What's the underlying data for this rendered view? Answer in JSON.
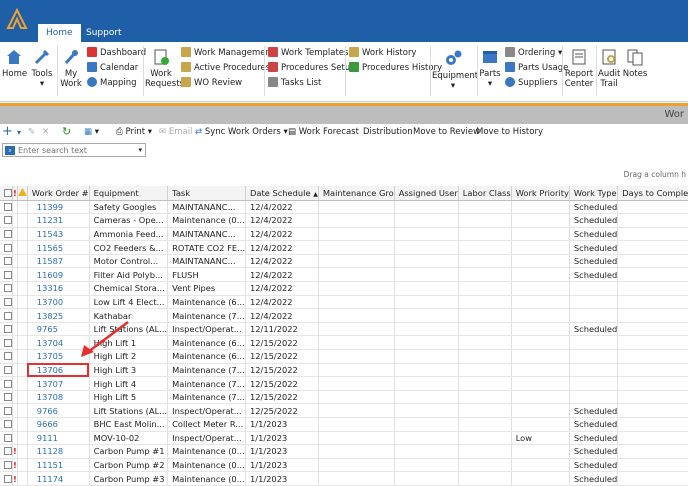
{
  "ribbon_tabs": {
    "home": "Home",
    "support": "Support"
  },
  "ribbon": {
    "home": "Home",
    "tools": "Tools",
    "my_work": "My Work",
    "dashboard": "Dashboard",
    "calendar": "Calendar",
    "mapping": "Mapping",
    "work_requests": "Work Requests",
    "work_management": "Work Management",
    "active_procedures": "Active Procedures",
    "wo_review": "WO Review",
    "work_templates": "Work Templates",
    "procedures_setup": "Procedures Setup",
    "tasks_list": "Tasks List",
    "work_history": "Work History",
    "procedures_history": "Procedures History",
    "equipment": "Equipment",
    "parts": "Parts",
    "ordering": "Ordering",
    "parts_usage": "Parts Usage",
    "suppliers": "Suppliers",
    "report_center": "Report Center",
    "audit_trail": "Audit Trail",
    "notes": "Notes"
  },
  "page_title_partial": "Wor",
  "toolbar": {
    "print": "Print",
    "email": "Email",
    "sync": "Sync Work Orders",
    "forecast": "Work Forecast",
    "distribution": "Distribution",
    "move_review": "Move to Review",
    "move_history": "Move to History"
  },
  "search": {
    "placeholder": "Enter search text"
  },
  "drag_hint": "Drag a column h",
  "columns": [
    "!",
    "Work Order #",
    "Equipment",
    "Task",
    "Date Schedule",
    "Maintenance Gro",
    "Assigned User",
    "Labor Class",
    "Work Priority",
    "Work Type",
    "Days to Complet"
  ],
  "rows": [
    {
      "p": "",
      "wo": "11399",
      "eq": "Safety Googles",
      "task": "MAINTANANC...",
      "date": "12/4/2022",
      "prio": "",
      "type": "Scheduled"
    },
    {
      "p": "",
      "wo": "11231",
      "eq": "Cameras - Ope...",
      "task": "Maintenance (0...",
      "date": "12/4/2022",
      "prio": "",
      "type": "Scheduled"
    },
    {
      "p": "",
      "wo": "11543",
      "eq": "Ammonia Feed...",
      "task": "MAINTANANC...",
      "date": "12/4/2022",
      "prio": "",
      "type": "Scheduled"
    },
    {
      "p": "",
      "wo": "11565",
      "eq": "CO2 Feeders &...",
      "task": "ROTATE CO2 FE...",
      "date": "12/4/2022",
      "prio": "",
      "type": "Scheduled"
    },
    {
      "p": "",
      "wo": "11587",
      "eq": "Motor Control...",
      "task": "MAINTANANC...",
      "date": "12/4/2022",
      "prio": "",
      "type": "Scheduled"
    },
    {
      "p": "",
      "wo": "11609",
      "eq": "Filter Aid Polyb...",
      "task": "FLUSH",
      "date": "12/4/2022",
      "prio": "",
      "type": "Scheduled"
    },
    {
      "p": "",
      "wo": "13316",
      "eq": "Chemical Stora...",
      "task": "Vent Pipes",
      "date": "12/4/2022",
      "prio": "",
      "type": ""
    },
    {
      "p": "",
      "wo": "13700",
      "eq": "Low Lift 4 Elect...",
      "task": "Maintenance (6...",
      "date": "12/4/2022",
      "prio": "",
      "type": ""
    },
    {
      "p": "",
      "wo": "13825",
      "eq": "Kathabar",
      "task": "Maintenance (7...",
      "date": "12/4/2022",
      "prio": "",
      "type": ""
    },
    {
      "p": "",
      "wo": "9765",
      "eq": "Lift Stations (AL...",
      "task": "Inspect/Operat...",
      "date": "12/11/2022",
      "prio": "",
      "type": "Scheduled"
    },
    {
      "p": "",
      "wo": "13704",
      "eq": "High Lift 1",
      "task": "Maintenance (6...",
      "date": "12/15/2022",
      "prio": "",
      "type": ""
    },
    {
      "p": "",
      "wo": "13705",
      "eq": "High Lift 2",
      "task": "Maintenance (6...",
      "date": "12/15/2022",
      "prio": "",
      "type": ""
    },
    {
      "p": "",
      "wo": "13706",
      "eq": "High Lift 3",
      "task": "Maintenance (7...",
      "date": "12/15/2022",
      "prio": "",
      "type": ""
    },
    {
      "p": "",
      "wo": "13707",
      "eq": "High Lift 4",
      "task": "Maintenance (7...",
      "date": "12/15/2022",
      "prio": "",
      "type": ""
    },
    {
      "p": "",
      "wo": "13708",
      "eq": "High Lift 5",
      "task": "Maintenance (7...",
      "date": "12/15/2022",
      "prio": "",
      "type": ""
    },
    {
      "p": "",
      "wo": "9766",
      "eq": "Lift Stations (AL...",
      "task": "Inspect/Operat...",
      "date": "12/25/2022",
      "prio": "",
      "type": "Scheduled"
    },
    {
      "p": "",
      "wo": "9666",
      "eq": "BHC East Molin...",
      "task": "Collect Meter R...",
      "date": "1/1/2023",
      "prio": "",
      "type": "Scheduled"
    },
    {
      "p": "",
      "wo": "9111",
      "eq": "MOV-10-02",
      "task": "Inspect/Operat...",
      "date": "1/1/2023",
      "prio": "Low",
      "type": "Scheduled"
    },
    {
      "p": "!",
      "wo": "11128",
      "eq": "Carbon Pump #1",
      "task": "Maintenance (0...",
      "date": "1/1/2023",
      "prio": "",
      "type": "Scheduled"
    },
    {
      "p": "!",
      "wo": "11151",
      "eq": "Carbon Pump #2",
      "task": "Maintenance (0...",
      "date": "1/1/2023",
      "prio": "",
      "type": "Scheduled"
    },
    {
      "p": "!",
      "wo": "11174",
      "eq": "Carbon Pump #3",
      "task": "Maintenance (0...",
      "date": "1/1/2023",
      "prio": "",
      "type": "Scheduled"
    }
  ],
  "colors": {
    "brand_blue": "#1e5fa8",
    "accent_orange": "#f0a030",
    "link_blue": "#2a6ebb",
    "annotation_red": "#e53030"
  }
}
